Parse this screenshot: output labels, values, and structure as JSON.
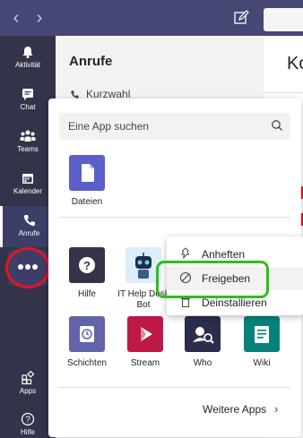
{
  "topbar": {
    "back_icon": "chevron-left-icon",
    "forward_icon": "chevron-right-icon",
    "compose_icon": "compose-icon"
  },
  "rail": {
    "items": [
      {
        "label": "Aktivität",
        "icon": "bell-icon"
      },
      {
        "label": "Chat",
        "icon": "chat-icon"
      },
      {
        "label": "Teams",
        "icon": "teams-icon"
      },
      {
        "label": "Kalender",
        "icon": "calendar-icon"
      },
      {
        "label": "Anrufe",
        "icon": "phone-icon",
        "active": true
      }
    ],
    "more_icon": "more-dots-icon",
    "bottom": [
      {
        "label": "Apps",
        "icon": "apps-icon"
      },
      {
        "label": "Hilfe",
        "icon": "help-icon"
      }
    ]
  },
  "calls": {
    "title": "Anrufe",
    "speed_dial": "Kurzwahl"
  },
  "right": {
    "header_partial": "Ko"
  },
  "flyout": {
    "search_placeholder": "Eine App suchen",
    "pinned": [
      {
        "name": "Dateien",
        "icon": "file-icon",
        "color": "#5b5fc7"
      }
    ],
    "apps": [
      {
        "name": "Hilfe",
        "icon": "question-icon",
        "color": "#33344a"
      },
      {
        "name": "IT Help Desk Bot",
        "icon": "robot-icon",
        "color": "#dbeefa"
      },
      {
        "name": "Schichten",
        "icon": "clock-icon",
        "color": "#6264a7"
      },
      {
        "name": "Stream",
        "icon": "play-icon",
        "color": "#bc1948"
      },
      {
        "name": "Who",
        "icon": "person-search-icon",
        "color": "#2b2d4b"
      },
      {
        "name": "Wiki",
        "icon": "wiki-icon",
        "color": "#07827a"
      }
    ],
    "more_apps": "Weitere Apps",
    "more_apps_icon": "chevron-right-icon"
  },
  "context_menu": {
    "items": [
      {
        "label": "Anheften",
        "icon": "pin-icon"
      },
      {
        "label": "Freigeben",
        "icon": "block-icon",
        "highlighted": true
      },
      {
        "label": "Deinstallieren",
        "icon": "trash-icon"
      }
    ]
  },
  "colors": {
    "accent": "#464775",
    "rail": "#33344a",
    "highlight_red": "#e81123",
    "highlight_green": "#2ebd1e"
  }
}
